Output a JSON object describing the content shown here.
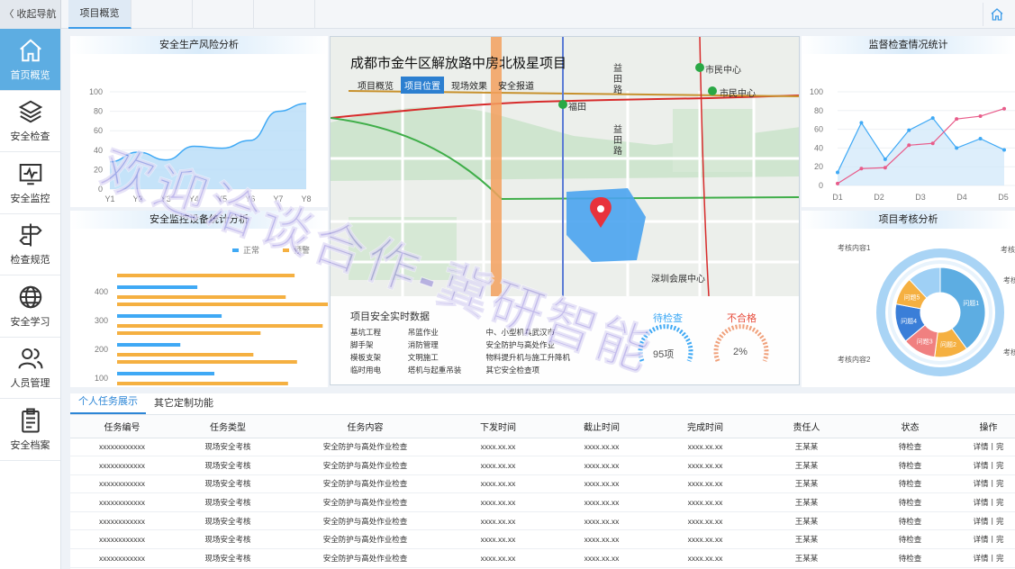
{
  "topbar": {
    "collapse_label": "〈 收起导航",
    "active_tab": "项目概览"
  },
  "sidebar": {
    "items": [
      {
        "label": "首页概览",
        "icon": "home-icon"
      },
      {
        "label": "安全检查",
        "icon": "layers-icon"
      },
      {
        "label": "安全监控",
        "icon": "monitor-icon"
      },
      {
        "label": "检查规范",
        "icon": "signpost-icon"
      },
      {
        "label": "安全学习",
        "icon": "globe-icon"
      },
      {
        "label": "人员管理",
        "icon": "users-icon"
      },
      {
        "label": "安全档案",
        "icon": "clipboard-icon"
      }
    ]
  },
  "panels": {
    "risk": "安全生产风险分析",
    "devices": "安全监控设备统计分析",
    "inspection": "监督检查情况统计",
    "assessment": "项目考核分析"
  },
  "chart_data": [
    {
      "type": "area",
      "title": "安全生产风险分析",
      "x": [
        "Y1",
        "Y2",
        "Y3",
        "Y4",
        "Y5",
        "Y6",
        "Y7",
        "Y8"
      ],
      "ylim": [
        0,
        100
      ],
      "yticks": [
        0,
        20,
        40,
        60,
        80,
        100
      ],
      "series": [
        {
          "values": [
            28,
            38,
            30,
            44,
            42,
            50,
            80,
            88
          ]
        }
      ]
    },
    {
      "type": "bar",
      "title": "安全监控设备统计分析",
      "categories": [
        "400",
        "300",
        "200",
        "100"
      ],
      "legend": [
        "正常",
        "预警"
      ],
      "series": [
        {
          "name": "正常",
          "values": [
            0.33,
            0.43,
            0.26,
            0.4
          ]
        },
        {
          "name": "预警",
          "values": [
            0.73,
            0.89,
            0.59,
            0.74
          ]
        }
      ]
    },
    {
      "type": "line",
      "title": "监督检查情况统计",
      "x": [
        "D1",
        "D2",
        "D3",
        "D4",
        "D5"
      ],
      "ylim": [
        0,
        100
      ],
      "yticks": [
        0,
        20,
        40,
        60,
        80,
        100
      ],
      "series": [
        {
          "values": [
            14,
            67,
            28,
            59,
            72,
            40,
            50,
            38
          ]
        },
        {
          "values": [
            2,
            18,
            19,
            43,
            45,
            71,
            74,
            82
          ]
        }
      ]
    },
    {
      "type": "pie",
      "title": "项目考核分析",
      "slices": [
        {
          "label": "问题1",
          "value": 40
        },
        {
          "label": "问题2",
          "value": 12
        },
        {
          "label": "问题3",
          "value": 12
        },
        {
          "label": "问题4",
          "value": 14
        },
        {
          "label": "问题5",
          "value": 10
        },
        {
          "label": "",
          "value": 12
        }
      ],
      "outer_labels": [
        "考核内容1",
        "考核",
        "考核",
        "考核",
        "考核内容2"
      ]
    }
  ],
  "map": {
    "title": "成都市金牛区解放路中房北极星项目",
    "tabs": [
      "项目概览",
      "项目位置",
      "现场效果",
      "安全报道"
    ],
    "active_tab": "项目位置",
    "labels": {
      "station1": "市民中心",
      "station2": "市民中心",
      "station3": "福田",
      "road1": "益田路",
      "road2": "益田路",
      "center": "深圳会展中心"
    },
    "realtime_title": "项目安全实时数据",
    "items": [
      [
        "基坑工程",
        "吊篮作业",
        "中、小型机具武汉市"
      ],
      [
        "脚手架",
        "消防管理",
        "安全防护与高处作业"
      ],
      [
        "模板支架",
        "文明施工",
        "物料提升机与施工升降机"
      ],
      [
        "临时用电",
        "塔机与起重吊装",
        "其它安全检查项"
      ]
    ],
    "pending_label": "待检查",
    "pending_value": "95项",
    "fail_label": "不合格",
    "fail_value": "2%"
  },
  "table": {
    "tabs": [
      "个人任务展示",
      "其它定制功能"
    ],
    "headers": [
      "任务编号",
      "任务类型",
      "任务内容",
      "下发时间",
      "截止时间",
      "完成时间",
      "责任人",
      "状态",
      "操作"
    ],
    "rows": [
      [
        "xxxxxxxxxxxx",
        "现场安全考核",
        "安全防护与高处作业检查",
        "xxxx.xx.xx",
        "xxxx.xx.xx",
        "xxxx.xx.xx",
        "王某某",
        "待检查",
        "详情丨完"
      ],
      [
        "xxxxxxxxxxxx",
        "现场安全考核",
        "安全防护与高处作业检查",
        "xxxx.xx.xx",
        "xxxx.xx.xx",
        "xxxx.xx.xx",
        "王某某",
        "待检查",
        "详情丨完"
      ],
      [
        "xxxxxxxxxxxx",
        "现场安全考核",
        "安全防护与高处作业检查",
        "xxxx.xx.xx",
        "xxxx.xx.xx",
        "xxxx.xx.xx",
        "王某某",
        "待检查",
        "详情丨完"
      ],
      [
        "xxxxxxxxxxxx",
        "现场安全考核",
        "安全防护与高处作业检查",
        "xxxx.xx.xx",
        "xxxx.xx.xx",
        "xxxx.xx.xx",
        "王某某",
        "待检查",
        "详情丨完"
      ],
      [
        "xxxxxxxxxxxx",
        "现场安全考核",
        "安全防护与高处作业检查",
        "xxxx.xx.xx",
        "xxxx.xx.xx",
        "xxxx.xx.xx",
        "王某某",
        "待检查",
        "详情丨完"
      ],
      [
        "xxxxxxxxxxxx",
        "现场安全考核",
        "安全防护与高处作业检查",
        "xxxx.xx.xx",
        "xxxx.xx.xx",
        "xxxx.xx.xx",
        "王某某",
        "待检查",
        "详情丨完"
      ],
      [
        "xxxxxxxxxxxx",
        "现场安全考核",
        "安全防护与高处作业检查",
        "xxxx.xx.xx",
        "xxxx.xx.xx",
        "xxxx.xx.xx",
        "王某某",
        "待检查",
        "详情丨完"
      ]
    ]
  },
  "watermark": "欢迎洽谈合作-冀研智能",
  "colors": {
    "accent": "#5dade2",
    "blue": "#3fa9f5",
    "orange": "#f5b041",
    "pink": "#e85c8a",
    "red": "#e74c3c"
  }
}
